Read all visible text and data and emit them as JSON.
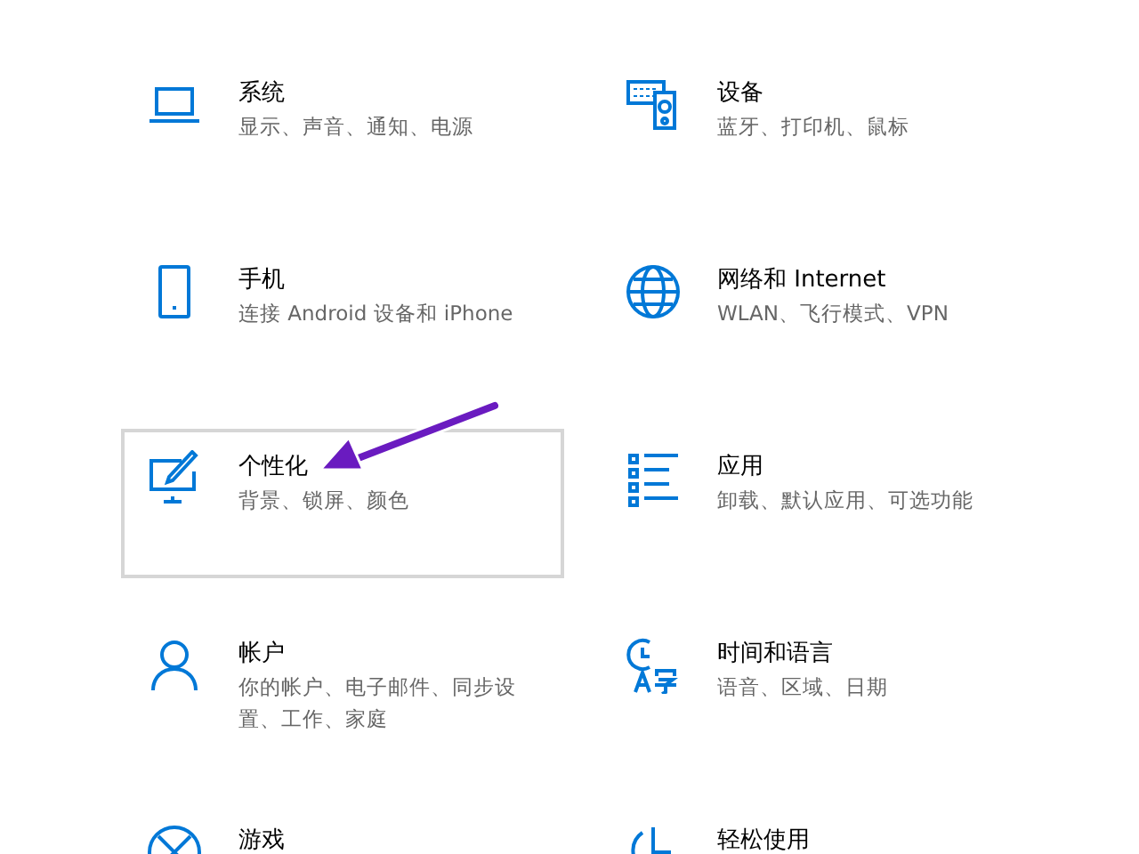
{
  "tiles": [
    {
      "title": "系统",
      "subtitle": "显示、声音、通知、电源",
      "hovered": false
    },
    {
      "title": "设备",
      "subtitle": "蓝牙、打印机、鼠标",
      "hovered": false
    },
    {
      "title": "手机",
      "subtitle": "连接 Android 设备和 iPhone",
      "hovered": false
    },
    {
      "title": "网络和 Internet",
      "subtitle": "WLAN、飞行模式、VPN",
      "hovered": false
    },
    {
      "title": "个性化",
      "subtitle": "背景、锁屏、颜色",
      "hovered": true
    },
    {
      "title": "应用",
      "subtitle": "卸载、默认应用、可选功能",
      "hovered": false
    },
    {
      "title": "帐户",
      "subtitle": "你的帐户、电子邮件、同步设置、工作、家庭",
      "hovered": false
    },
    {
      "title": "时间和语言",
      "subtitle": "语音、区域、日期",
      "hovered": false
    },
    {
      "title": "游戏",
      "hovered": false
    },
    {
      "title": "轻松使用",
      "hovered": false
    }
  ]
}
